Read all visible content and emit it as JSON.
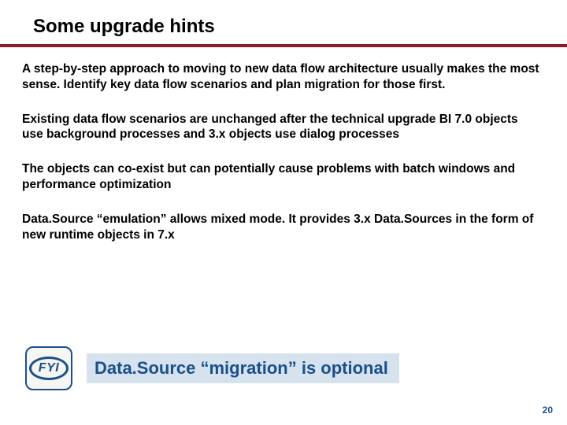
{
  "title": "Some upgrade hints",
  "paragraphs": [
    "A step-by-step approach to moving to new data flow architecture usually makes the most sense. Identify key data flow scenarios and plan migration for those first.",
    "Existing data flow scenarios are unchanged after the technical upgrade BI 7.0 objects use background processes and 3.x objects use dialog processes",
    "The objects can co-exist but can potentially cause problems with batch windows and performance optimization",
    "Data.Source “emulation” allows mixed mode. It provides 3.x Data.Sources in the form of new runtime objects in 7.x"
  ],
  "fyi_label": "FYI",
  "callout": "Data.Source “migration” is optional",
  "page_number": "20"
}
